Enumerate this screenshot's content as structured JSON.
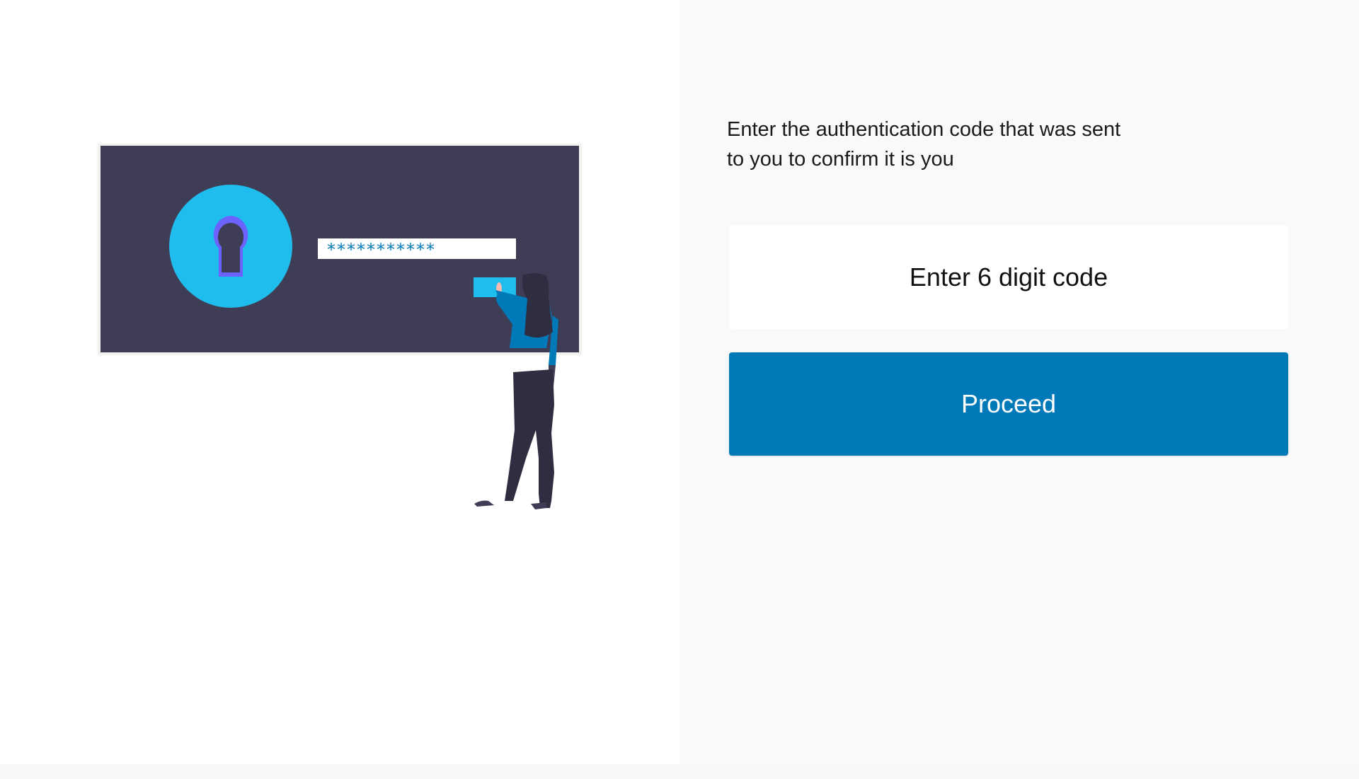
{
  "illustration": {
    "password_mask": "***********",
    "colors": {
      "screen": "#3f3d56",
      "accent": "#1fbded",
      "keyhole": "#6c63ff",
      "shirt": "#0079b9"
    }
  },
  "form": {
    "instructions_line1": "Enter the authentication code that was sent",
    "instructions_line2": "to you to confirm it is you",
    "code_placeholder": "Enter 6 digit code",
    "code_value": "",
    "proceed_label": "Proceed"
  },
  "colors": {
    "primary": "#0079b9",
    "panel_bg": "#f9f9f9"
  }
}
